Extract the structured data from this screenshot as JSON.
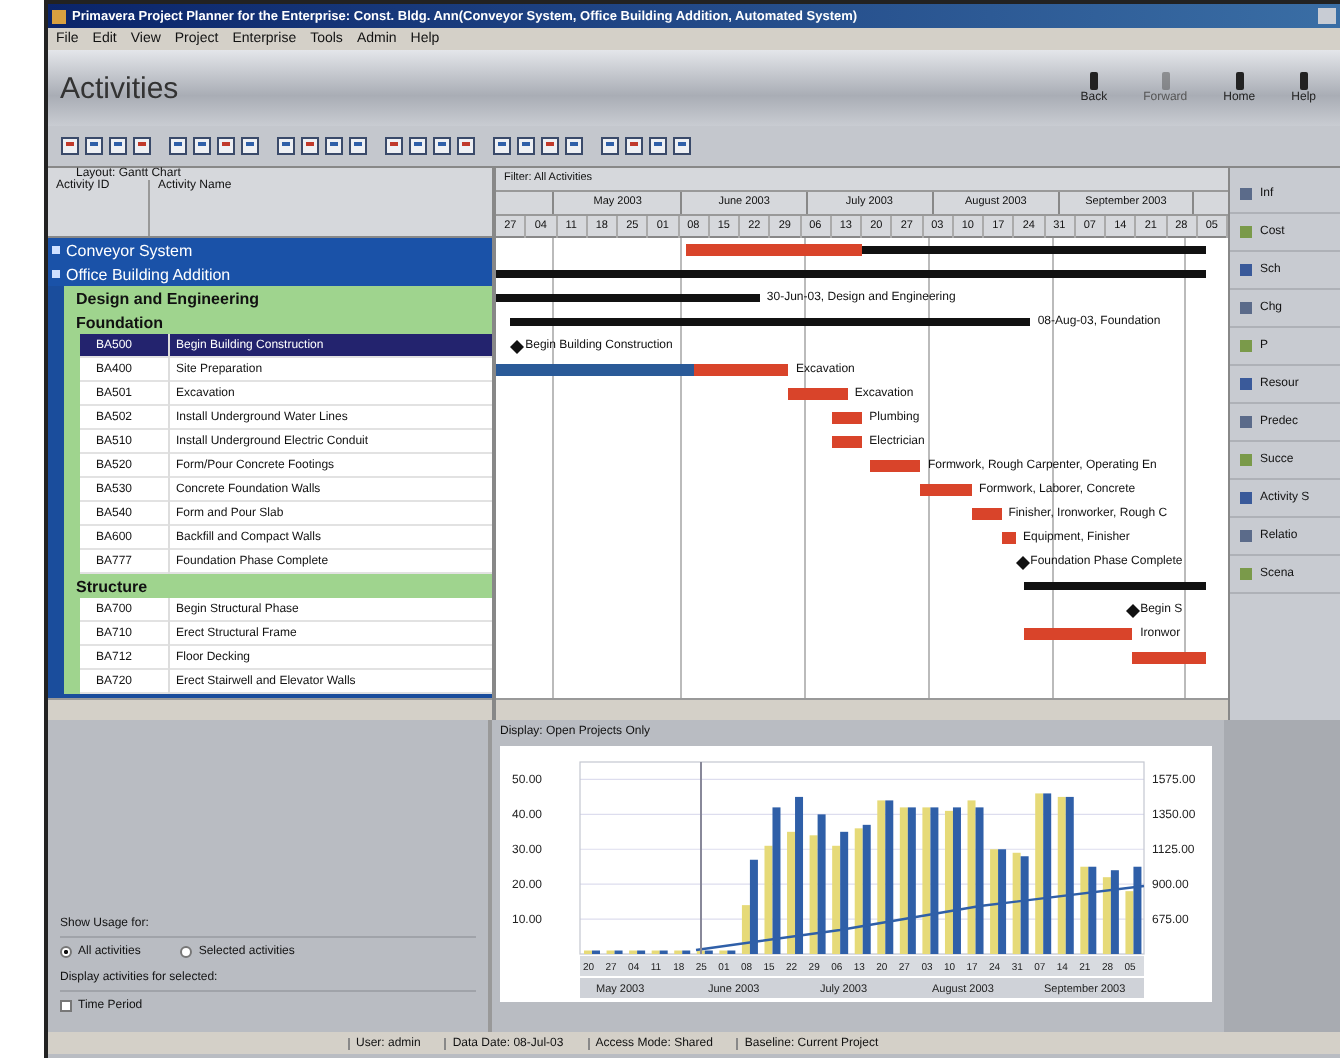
{
  "window": {
    "title": "Primavera Project Planner for the Enterprise: Const. Bldg. Ann(Conveyor System, Office Building Addition, Automated System)"
  },
  "menu": [
    "File",
    "Edit",
    "View",
    "Project",
    "Enterprise",
    "Tools",
    "Admin",
    "Help"
  ],
  "header": {
    "title": "Activities",
    "nav": [
      {
        "label": "Back",
        "disabled": false
      },
      {
        "label": "Forward",
        "disabled": true
      },
      {
        "label": "Home",
        "disabled": false
      },
      {
        "label": "Help",
        "disabled": false
      }
    ]
  },
  "table": {
    "layout": "Layout: Gantt Chart",
    "columns": [
      "Activity ID",
      "Activity Name"
    ]
  },
  "wbs": [
    {
      "name": "Conveyor System"
    },
    {
      "name": "Office Building Addition",
      "children": [
        {
          "name": "Design and Engineering",
          "bar_label": "30-Jun-03, Design and Engineering"
        },
        {
          "name": "Foundation",
          "bar_label": "08-Aug-03, Foundation",
          "activities": [
            {
              "id": "BA500",
              "name": "Begin Building Construction",
              "bar_label": "Begin Building Construction",
              "selected": true
            },
            {
              "id": "BA400",
              "name": "Site Preparation",
              "bar_label": "Excavation",
              "selected": false
            },
            {
              "id": "BA501",
              "name": "Excavation",
              "bar_label": "Excavation",
              "selected": false
            },
            {
              "id": "BA502",
              "name": "Install Underground Water Lines",
              "bar_label": "Plumbing",
              "selected": false
            },
            {
              "id": "BA510",
              "name": "Install Underground Electric Conduit",
              "bar_label": "Electrician",
              "selected": false
            },
            {
              "id": "BA520",
              "name": "Form/Pour Concrete Footings",
              "bar_label": "Formwork, Rough Carpenter, Operating En",
              "selected": false
            },
            {
              "id": "BA530",
              "name": "Concrete Foundation Walls",
              "bar_label": "Formwork, Laborer, Concrete",
              "selected": false
            },
            {
              "id": "BA540",
              "name": "Form and Pour Slab",
              "bar_label": "Finisher, Ironworker, Rough C",
              "selected": false
            },
            {
              "id": "BA600",
              "name": "Backfill and Compact Walls",
              "bar_label": "Equipment, Finisher",
              "selected": false
            },
            {
              "id": "BA777",
              "name": "Foundation Phase Complete",
              "bar_label": "Foundation Phase Complete",
              "selected": false
            }
          ]
        },
        {
          "name": "Structure",
          "activities": [
            {
              "id": "BA700",
              "name": "Begin Structural Phase",
              "bar_label": "Begin S",
              "selected": false
            },
            {
              "id": "BA710",
              "name": "Erect Structural Frame",
              "bar_label": "Ironwor",
              "selected": false
            },
            {
              "id": "BA712",
              "name": "Floor Decking",
              "selected": false
            },
            {
              "id": "BA720",
              "name": "Erect Stairwell and Elevator Walls",
              "selected": false
            }
          ]
        }
      ]
    }
  ],
  "gantt": {
    "caption": "Filter: All Activities",
    "months": [
      "May 2003",
      "June 2003",
      "July 2003",
      "August 2003",
      "September 2003"
    ],
    "weeks": [
      "27",
      "04",
      "11",
      "18",
      "25",
      "01",
      "08",
      "15",
      "22",
      "29",
      "06",
      "13",
      "20",
      "27",
      "03",
      "10",
      "17",
      "24",
      "31",
      "07",
      "14",
      "21",
      "28",
      "05"
    ]
  },
  "side_panel": [
    {
      "label": "Inf"
    },
    {
      "label": "Cost"
    },
    {
      "label": "Sch"
    },
    {
      "label": "Chg"
    },
    {
      "label": "P"
    },
    {
      "label": "Resour"
    },
    {
      "label": "Predec"
    },
    {
      "label": "Succe"
    },
    {
      "label": "Activity S"
    },
    {
      "label": "Relatio"
    },
    {
      "label": "Scena"
    }
  ],
  "usage": {
    "show_label": "Show Usage for:",
    "options": [
      {
        "label": "All activities",
        "selected": true
      },
      {
        "label": "Selected activities",
        "selected": false
      }
    ],
    "display_label": "Display activities for selected:",
    "time_period": {
      "label": "Time Period",
      "checked": false
    }
  },
  "chart": {
    "caption": "Display: Open Projects Only",
    "right_axis_labels": [
      "1575.00",
      "1350.00",
      "1125.00",
      "900.00",
      "675.00"
    ],
    "month_labels": [
      "May 2003",
      "June 2003",
      "July 2003",
      "August 2003",
      "September 2003"
    ],
    "chart_data": {
      "type": "bar",
      "categories": [
        "20",
        "27",
        "04",
        "11",
        "18",
        "25",
        "01",
        "08",
        "15",
        "22",
        "29",
        "06",
        "13",
        "20",
        "27",
        "03",
        "10",
        "17",
        "24",
        "31",
        "07",
        "14",
        "21",
        "28",
        "05"
      ],
      "series": [
        {
          "color": "#e6da78",
          "values": [
            1,
            1,
            1,
            1,
            1,
            1,
            1,
            14,
            31,
            35,
            34,
            31,
            36,
            44,
            42,
            42,
            41,
            44,
            30,
            29,
            46,
            45,
            25,
            22,
            18
          ]
        },
        {
          "color": "#2f5fa8",
          "values": [
            1,
            1,
            1,
            1,
            1,
            1,
            1,
            27,
            42,
            45,
            40,
            35,
            37,
            44,
            42,
            42,
            42,
            42,
            30,
            28,
            46,
            45,
            25,
            24,
            25
          ]
        }
      ],
      "ylim": [
        0,
        55
      ],
      "grid": true,
      "yticks": [
        {
          "value": 10,
          "label": "10.00"
        },
        {
          "value": 20,
          "label": "20.00"
        },
        {
          "value": 30,
          "label": "30.00"
        },
        {
          "value": 40,
          "label": "40.00"
        },
        {
          "value": 50,
          "label": "50.00"
        }
      ]
    }
  },
  "status_bar": [
    "User: admin",
    "Data Date: 08-Jul-03",
    "Access Mode: Shared",
    "Baseline: Current Project"
  ]
}
